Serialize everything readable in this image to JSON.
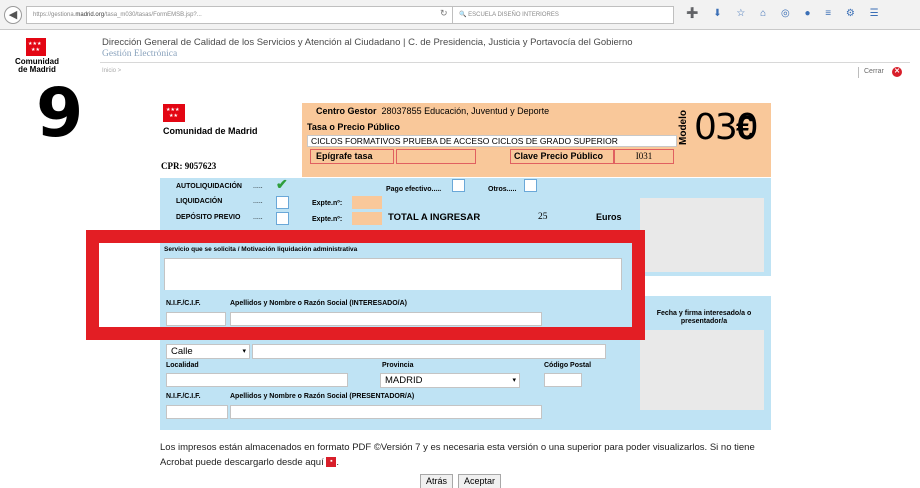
{
  "browser": {
    "url_prefix": "https://gestiona.",
    "url_domain": "madrid.org",
    "url_rest": "/tasa_m030/tasas/FormEMSB.jsp?...",
    "search_text": "ESCUELA DISEÑO INTERIORES"
  },
  "header": {
    "logo_line1": "Comunidad",
    "logo_line2": "de Madrid",
    "department": "Dirección General de Calidad de los Servicios y Atención al Ciudadano | C. de Presidencia, Justicia y Portavocía del Gobierno",
    "subtitle": "Gestión Electrónica",
    "small_link": "Inicio >",
    "cerrar": "Cerrar"
  },
  "step_number": "9",
  "form": {
    "logo_text": "Comunidad de Madrid",
    "cpr": "CPR: 9057623",
    "centro_gestor_label": "Centro Gestor",
    "centro_gestor_value": "28037855 Educación, Juventud y Deporte",
    "tasa_label": "Tasa o Precio Público",
    "tasa_value": "CICLOS FORMATIVOS PRUEBA DE ACCESO CICLOS DE GRADO SUPERIOR",
    "epigrafe_label": "Epígrafe tasa",
    "clave_label": "Clave Precio Público",
    "clave_value": "I031",
    "modelo_label": "Modelo",
    "modelo_number": "030",
    "euro_symbol": "€",
    "autoliquidacion": "AUTOLIQUIDACIÓN",
    "liquidacion": "LIQUIDACIÓN",
    "deposito": "DEPÓSITO PREVIO",
    "dots": ".....",
    "pago_efectivo": "Pago efectivo.....",
    "otros": "Otros.....",
    "expte1": "Expte.nº:",
    "expte2": "Expte.nº:",
    "total_label": "TOTAL A INGRESAR",
    "total_value": "25",
    "euros": "Euros",
    "servicio_label": "Servicio que se solicita / Motivación liquidación administrativa",
    "nif_label": "N.I.F./C.I.F.",
    "apellidos_label": "Apellidos y Nombre o Razón Social (INTERESADO/A)",
    "firma_label": "Fecha y firma interesado/a o presentador/a",
    "via_value": "Calle",
    "localidad_label": "Localidad",
    "provincia_label": "Provincia",
    "provincia_value": "MADRID",
    "cp_label": "Código Postal",
    "nif2_label": "N.I.F./C.I.F.",
    "apellidos2_label": "Apellidos y Nombre o Razón Social (PRESENTADOR/A)"
  },
  "footer": {
    "text": "Los impresos están almacenados en formato PDF ©Versión 7 y es necesaria esta versión o una superior para poder visualizarlos. Si no tiene Acrobat puede descargarlo desde aquí",
    "atras": "Atrás",
    "aceptar": "Aceptar"
  },
  "colors": {
    "highlight": "#e31e24",
    "orange_panel": "#f9c89a",
    "blue_panel": "#bfe3f4",
    "brand_red": "#e30613"
  }
}
